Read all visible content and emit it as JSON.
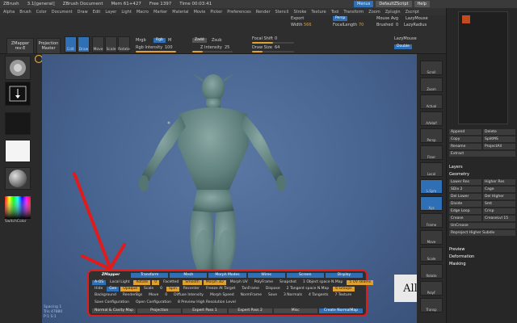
{
  "titlebar": {
    "app": "ZBrush",
    "version": "3.1[general]",
    "doc": "ZBrush Document",
    "mem": "Mem 61+427",
    "free": "Free 1397",
    "time": "Time 00:03:41",
    "menus_btn": "Menus",
    "script_btn": "DefaultZScript",
    "help_btn": "Help"
  },
  "menubar": [
    "Alpha",
    "Brush",
    "Color",
    "Document",
    "Draw",
    "Edit",
    "Layer",
    "Light",
    "Macro",
    "Marker",
    "Material",
    "Movie",
    "Picker",
    "Preferences",
    "Render",
    "Stencil",
    "Stroke",
    "Texture",
    "Tool",
    "Transform",
    "Zoom",
    "Zplugin",
    "Zscript"
  ],
  "toolbar": {
    "projection_master": "Projection Master",
    "zmapper_btn": "ZMapper",
    "zmapper_sub": "rev-E",
    "edit": "Edit",
    "draw": "Draw",
    "move": "Move",
    "scale": "Scale",
    "rotate": "Rotate",
    "mrgb": "Mrgb",
    "rgb": "Rgb",
    "m": "M",
    "rgb_intensity": "Rgb Intensity",
    "rgb_intensity_val": "100",
    "zadd": "Zadd",
    "zsub": "Zsub",
    "z_intensity": "Z Intensity",
    "z_intensity_val": "25",
    "focal_shift": "Focal Shift",
    "focal_shift_val": "0",
    "draw_size": "Draw Size",
    "draw_size_val": "64",
    "export": "Export",
    "width": "Width",
    "width_val": "566",
    "focal_length": "FocalLength",
    "focal_length_val": "70",
    "persp": "Persp",
    "mouse_avg": "Mouse Avg",
    "brushed": "Brushed",
    "brushed_val": "0",
    "lazy_mouse": "LazyMouse",
    "lazy_radius": "LazyRadius",
    "double": "Double"
  },
  "left_shelf": {
    "switch_color": "SwitchColor"
  },
  "viewport": {
    "ruler": [
      "Spacing 1",
      "Tris 47880",
      "P:1 S:1"
    ]
  },
  "zmapper": {
    "tabs": [
      "ZMapper",
      "Transform",
      "Mesh",
      "Morph Modes",
      "Wires",
      "Screen",
      "Display"
    ],
    "row2": [
      {
        "t": "A-OS",
        "s": "b"
      },
      {
        "t": "Local Light",
        "s": "t"
      },
      {
        "t": "Rotate",
        "s": "y"
      },
      {
        "t": "0",
        "s": "y"
      },
      {
        "t": "Facetted",
        "s": "t"
      },
      {
        "t": "Smooth",
        "s": "y"
      },
      {
        "t": "Morph 3D",
        "s": "y"
      },
      {
        "t": "Morph UV",
        "s": "t"
      },
      {
        "t": "PolyFrame",
        "s": "t"
      },
      {
        "t": "Snapshot",
        "s": "t"
      },
      {
        "t": "1 Object space N.Map",
        "s": "t"
      },
      {
        "t": "5 UV seams",
        "s": "y"
      }
    ],
    "row3": [
      {
        "t": "Hide",
        "s": "t"
      },
      {
        "t": "Gen",
        "s": "b"
      },
      {
        "t": "Opaque",
        "s": "y"
      },
      {
        "t": "Scale",
        "s": "t"
      },
      {
        "t": "0",
        "s": "t"
      },
      {
        "t": "Spin",
        "s": "y"
      },
      {
        "t": "Recenter",
        "s": "t"
      },
      {
        "t": "Freeze At Target",
        "s": "t"
      },
      {
        "t": "TanFrame",
        "s": "t"
      },
      {
        "t": "Dispose",
        "s": "t"
      },
      {
        "t": "2 Tangent space N.Map",
        "s": "t"
      },
      {
        "t": "6 Groups",
        "s": "y"
      }
    ],
    "row4": [
      {
        "t": "Background",
        "s": "t"
      },
      {
        "t": "RenderBgs",
        "s": "t"
      },
      {
        "t": "Move",
        "s": "t"
      },
      {
        "t": "0",
        "s": "t"
      },
      {
        "t": "Diffuse Intensity",
        "s": "t"
      },
      {
        "t": "Morph Speed",
        "s": "t"
      },
      {
        "t": "NormFrame",
        "s": "t"
      },
      {
        "t": "Save",
        "s": "t"
      },
      {
        "t": "3 Normals",
        "s": "t"
      },
      {
        "t": "4 Tangents",
        "s": "t"
      },
      {
        "t": "7 Texture",
        "s": "t"
      }
    ],
    "row5": [
      {
        "t": "Save Configuration",
        "s": "t"
      },
      {
        "t": "Open Configuration",
        "s": "t"
      },
      {
        "t": "8 Preview High Resolution Level",
        "s": "t"
      }
    ],
    "row6": [
      "Normal & Cavity Map",
      "Projection",
      "Expert Pass 1",
      "Expert Pass 2",
      "Misc",
      "Create NormalMap"
    ]
  },
  "watermark": "Allah akbar",
  "right_shelf": [
    "Scroll",
    "Zoom",
    "Actual",
    "AAHalf",
    "Persp",
    "Floor",
    "Local",
    "L.Sym",
    "Xyz",
    "Frame",
    "Move",
    "Scale",
    "Rotate",
    "PolyF",
    "Transp"
  ],
  "palette": {
    "top_rows": [
      [
        "Append",
        "Delete"
      ],
      [
        "Copy",
        "SplitMS"
      ],
      [
        "Rename",
        "ProjectAll"
      ],
      [
        "Extract"
      ]
    ],
    "layers": "Layers",
    "geometry": "Geometry",
    "geo_rows": [
      [
        "Lower Res",
        "Higher Res"
      ],
      [
        "SDiv 2",
        "Cage"
      ],
      [
        "Del Lower",
        "Del Higher"
      ],
      [
        "Divide",
        "Smt"
      ],
      [
        "Edge Loop",
        "Crisp"
      ],
      [
        "Crease",
        "CreaseLvl 15"
      ],
      [
        "UnCrease"
      ],
      [
        "Reproject Higher Subdiv"
      ]
    ],
    "bottom": [
      "Preview",
      "Deformation",
      "Masking"
    ]
  }
}
